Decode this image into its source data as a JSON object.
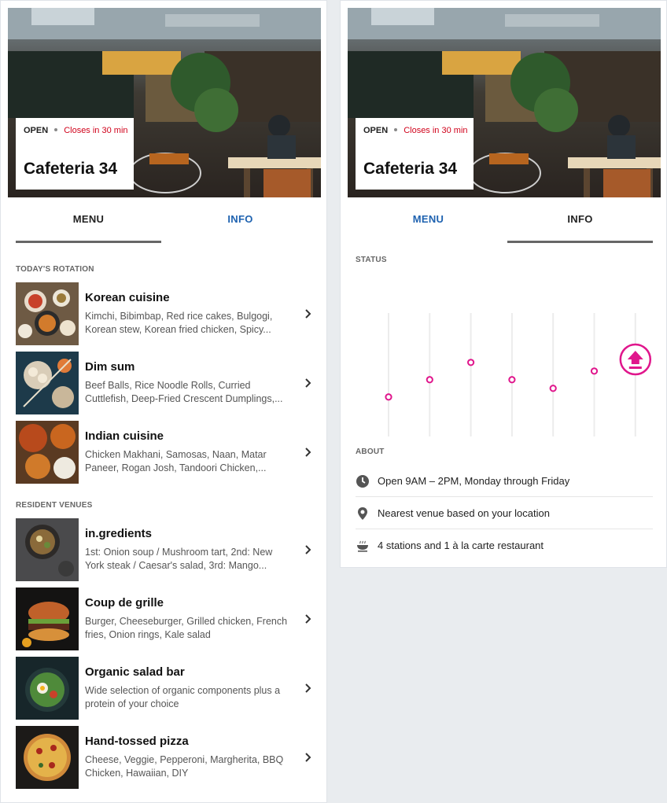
{
  "venue": {
    "status": "OPEN",
    "closing": "Closes in 30 min",
    "name": "Cafeteria 34"
  },
  "tabs": {
    "menu": "MENU",
    "info": "INFO"
  },
  "menu": {
    "rotation_label": "TODAY'S ROTATION",
    "rotation": [
      {
        "title": "Korean cuisine",
        "desc": "Kimchi, Bibimbap, Red rice cakes, Bulgogi, Korean stew, Korean fried chicken, Spicy..."
      },
      {
        "title": "Dim sum",
        "desc": "Beef Balls, Rice Noodle Rolls, Curried Cuttlefish, Deep-Fried Crescent Dumplings,..."
      },
      {
        "title": "Indian cuisine",
        "desc": "Chicken Makhani, Samosas, Naan, Matar Paneer, Rogan Josh, Tandoori Chicken,..."
      }
    ],
    "resident_label": "RESIDENT VENUES",
    "resident": [
      {
        "title": "in.gredients",
        "desc": "1st: Onion soup / Mushroom tart, 2nd: New York steak / Caesar's salad, 3rd: Mango..."
      },
      {
        "title": "Coup de grille",
        "desc": "Burger, Cheeseburger, Grilled chicken, French fries, Onion rings, Kale salad"
      },
      {
        "title": "Organic salad bar",
        "desc": "Wide selection of organic components plus a protein of your choice"
      },
      {
        "title": "Hand-tossed pizza",
        "desc": "Cheese, Veggie, Pepperoni, Margherita, BBQ Chicken, Hawaiian, DIY"
      }
    ]
  },
  "info": {
    "status_label": "STATUS",
    "about_label": "ABOUT",
    "about": [
      {
        "icon": "clock-icon",
        "text": "Open 9AM – 2PM, Monday through Friday"
      },
      {
        "icon": "location-pin-icon",
        "text": "Nearest venue based on your location"
      },
      {
        "icon": "dish-icon",
        "text": "4 stations and 1 à la carte restaurant"
      }
    ]
  },
  "chart_data": {
    "type": "scatter",
    "title": "",
    "xlabel": "",
    "ylabel": "",
    "x": [
      1,
      2,
      3,
      4,
      5,
      6,
      7
    ],
    "values": [
      0.32,
      0.46,
      0.6,
      0.46,
      0.39,
      0.53,
      null
    ],
    "ylim": [
      0,
      1
    ],
    "grid": true,
    "marker_color": "#e0168c",
    "current_marker": "up-arrow-icon"
  },
  "colors": {
    "accent": "#e0168c",
    "link": "#1e62b0",
    "closing": "#d0021b"
  }
}
